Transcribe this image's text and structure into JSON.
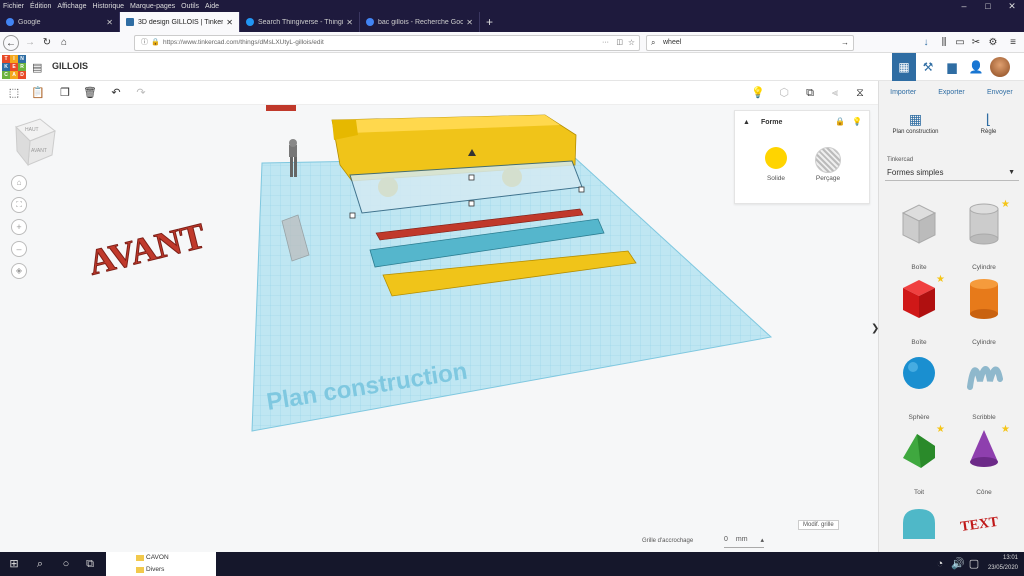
{
  "menubar": [
    "Fichier",
    "Édition",
    "Affichage",
    "Historique",
    "Marque-pages",
    "Outils",
    "Aide"
  ],
  "window_controls": [
    "–",
    "□",
    "✕"
  ],
  "tabs": [
    {
      "label": "Google",
      "active": false,
      "color": "#4285f4"
    },
    {
      "label": "3D design GILLOIS | Tinkercad",
      "active": true,
      "color": "#2f6da3"
    },
    {
      "label": "Search Thingiverse - Thingiverse",
      "active": false,
      "color": "#2196f3"
    },
    {
      "label": "bac gillois - Recherche Google",
      "active": false,
      "color": "#4285f4"
    }
  ],
  "newtab": "+",
  "url": "https://www.tinkercad.com/things/dMsLXUtyL-gillois/edit",
  "search_value": "wheel",
  "tinkercad": {
    "logo_letters": [
      "T",
      "I",
      "N",
      "K",
      "E",
      "R",
      "C",
      "A",
      "D"
    ],
    "logo_colors": [
      "#e84a27",
      "#f4a81d",
      "#2f6da3",
      "#2f6da3",
      "#e84a27",
      "#6cb33e",
      "#6cb33e",
      "#f4a81d",
      "#e84a27"
    ],
    "design_title": "GILLOIS",
    "import_label": "Importer",
    "export_label": "Exporter",
    "send_label": "Envoyer"
  },
  "viewcube": {
    "top": "HAUT",
    "front": "AVANT"
  },
  "workplane_label": "Plan construction",
  "avant_text": "AVANT",
  "inspector": {
    "title": "Forme",
    "solid_label": "Solide",
    "hole_label": "Perçage",
    "solid_color": "#ffd400"
  },
  "panel": {
    "plan_label": "Plan construction",
    "ruler_label": "Règle",
    "lib_label": "Tinkercad",
    "lib_value": "Formes simples",
    "shapes": [
      {
        "label": "Boîte",
        "star": false
      },
      {
        "label": "Cylindre",
        "star": true
      },
      {
        "label": "Boîte",
        "star": true
      },
      {
        "label": "Cylindre",
        "star": false
      },
      {
        "label": "Sphère",
        "star": false
      },
      {
        "label": "Scribble",
        "star": false
      },
      {
        "label": "Toit",
        "star": true
      },
      {
        "label": "Cône",
        "star": true
      },
      {
        "label": "",
        "star": false
      },
      {
        "label": "",
        "star": false
      }
    ]
  },
  "grid_status": {
    "edit_grid": "Modif. grille",
    "snap_label": "Grille d'accrochage",
    "snap_value": "0",
    "snap_unit": "mm"
  },
  "explorer": [
    "CAVON",
    "Divers"
  ],
  "clock": {
    "time": "13:01",
    "date": "23/05/2020"
  }
}
